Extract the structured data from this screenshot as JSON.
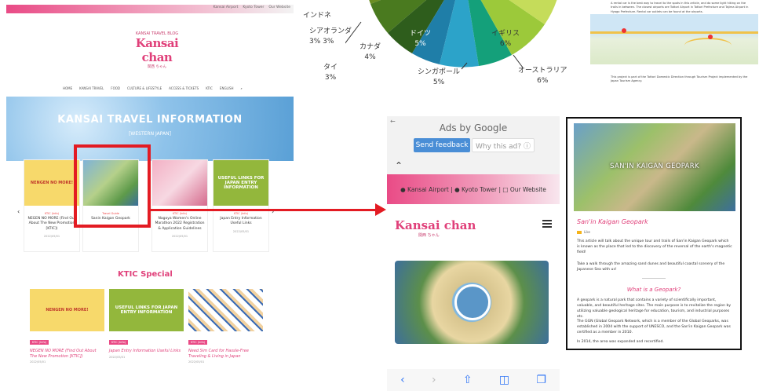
{
  "desktop": {
    "topbar_links": [
      "Kansai Airport",
      "Kyoto Tower",
      "Our Website"
    ],
    "logo_small": "KANSAI TRAVEL BLOG",
    "logo": "Kansai chan",
    "logo_jp": "関西 ちゃん",
    "nav": [
      "HOME",
      "KANSAI TRAVEL",
      "FOOD",
      "CULTURE & LIFESTYLE",
      "ACCESS & TICKETS",
      "KTIC",
      "ENGLISH",
      "⌕"
    ],
    "hero_title": "KANSAI TRAVEL INFORMATION",
    "hero_subtitle": "[WESTERN JAPAN]",
    "cards": [
      {
        "label": "NENGEN NO MORE!",
        "tag": "KTIC (Info)",
        "caption": "NEGEN NO MORE (Find Out About The New Promotion [KTIC])",
        "date": "2022/05/01"
      },
      {
        "label": "",
        "tag": "Travel Guide",
        "caption": "Sanin Kaigan Geopark",
        "date": "2022/05/01"
      },
      {
        "label": "",
        "tag": "KTIC (Info)",
        "caption": "Nagoya Women's Online Marathon 2022 Registration & Application Guidelines",
        "date": "2022/05/01"
      },
      {
        "label": "USEFUL LINKS FOR JAPAN ENTRY INFORMATION",
        "tag": "KTIC (Info)",
        "caption": "Japan Entry Information Useful Links",
        "date": "2022/05/01"
      }
    ],
    "section_title": "KTIC Special",
    "ktic_cards": [
      {
        "label": "NENGEN NO MORE!",
        "tag": "KTIC (Info)",
        "title": "NEGEN NO MORE (Find Out About The New Promotion [KTIC])",
        "date": "2022/05/01"
      },
      {
        "label": "USEFUL LINKS FOR JAPAN ENTRY INFORMATION",
        "tag": "KTIC (Info)",
        "title": "Japan Entry Information Useful Links",
        "date": "2022/05/01"
      },
      {
        "label": "",
        "tag": "KTIC (Info)",
        "title": "Need Sim Card for Hassle-Free Traveling & Living in Japan",
        "date": "2022/05/01"
      }
    ]
  },
  "pie": {
    "labels": [
      {
        "name": "インドネ",
        "value": ""
      },
      {
        "name": "シアオランダ",
        "value": "3% 3%"
      },
      {
        "name": "カナダ",
        "value": "4%"
      },
      {
        "name": "タイ",
        "value": "3%"
      },
      {
        "name": "ドイツ",
        "value": "5%"
      },
      {
        "name": "シンガポール",
        "value": "5%"
      },
      {
        "name": "イギリス",
        "value": "6%"
      },
      {
        "name": "オーストラリア",
        "value": "6%"
      }
    ]
  },
  "phone": {
    "ads_by": "Ads by Google",
    "feedback": "Send feedback",
    "why": "Why this ad? ⓘ",
    "topbar": "● Kansai Airport  |  ● Kyoto Tower  |  □ Our Website",
    "logo": "Kansai chan",
    "logo_jp": "関西 ちゃん"
  },
  "doc": {
    "image_title": "SAN'IN KAIGAN GEOPARK",
    "heading": "San'in Kaigan Geopark",
    "author": "Like",
    "p1": "This article will talk about the unique tour and trails of San'in Kaigan Geopark which is known as the place that led to the discovery of the reversal of the earth's magnetic field!",
    "p2": "Take a walk through the amazing sand dunes and beautiful coastal scenery of the Japanese Sea with us!",
    "h2": "What is a Geopark?",
    "p3": "A geopark is a natural park that contains a variety of scientifically important, valuable, and beautiful heritage sites. The main purpose is to revitalize the region by utilizing valuable geological heritage for education, tourism, and industrial purposes etc.",
    "p4": "The GGN (Global Geopark Network, which is a member of the Global Geoparks, was established in 2004 with the support of UNESCO, and the San'in Kaigan Geopark was certified as a member in 2010.",
    "p5": "In 2014, the area was expanded and recertified."
  },
  "map": {
    "top_text": "A rental car is the best way to travel to the spots in this article, and do some light hiking on the trails in between. The closest airports are Tottori Airport in Tottori Prefecture and Tajima Airport in Hyogo Prefecture. Rental car outlets can be found at the airports.",
    "bottom_text": "This project is part of the Tottori Domestic Direction through Tourism Project implemented by the Japan Tourism Agency."
  }
}
